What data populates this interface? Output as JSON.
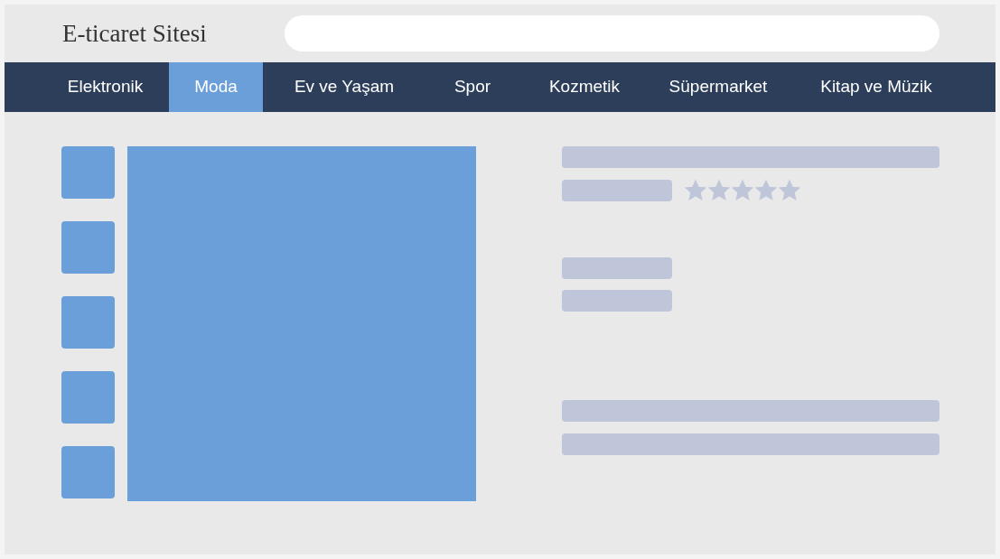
{
  "site_title": "E-ticaret Sitesi",
  "nav": [
    {
      "label": "Elektronik",
      "selected": false
    },
    {
      "label": "Moda",
      "selected": true
    },
    {
      "label": "Ev ve Yaşam",
      "selected": false
    },
    {
      "label": "Spor",
      "selected": false
    },
    {
      "label": "Kozmetik",
      "selected": false
    },
    {
      "label": "Süpermarket",
      "selected": false
    },
    {
      "label": "Kitap ve Müzik",
      "selected": false
    }
  ],
  "product": {
    "stars": 5
  }
}
